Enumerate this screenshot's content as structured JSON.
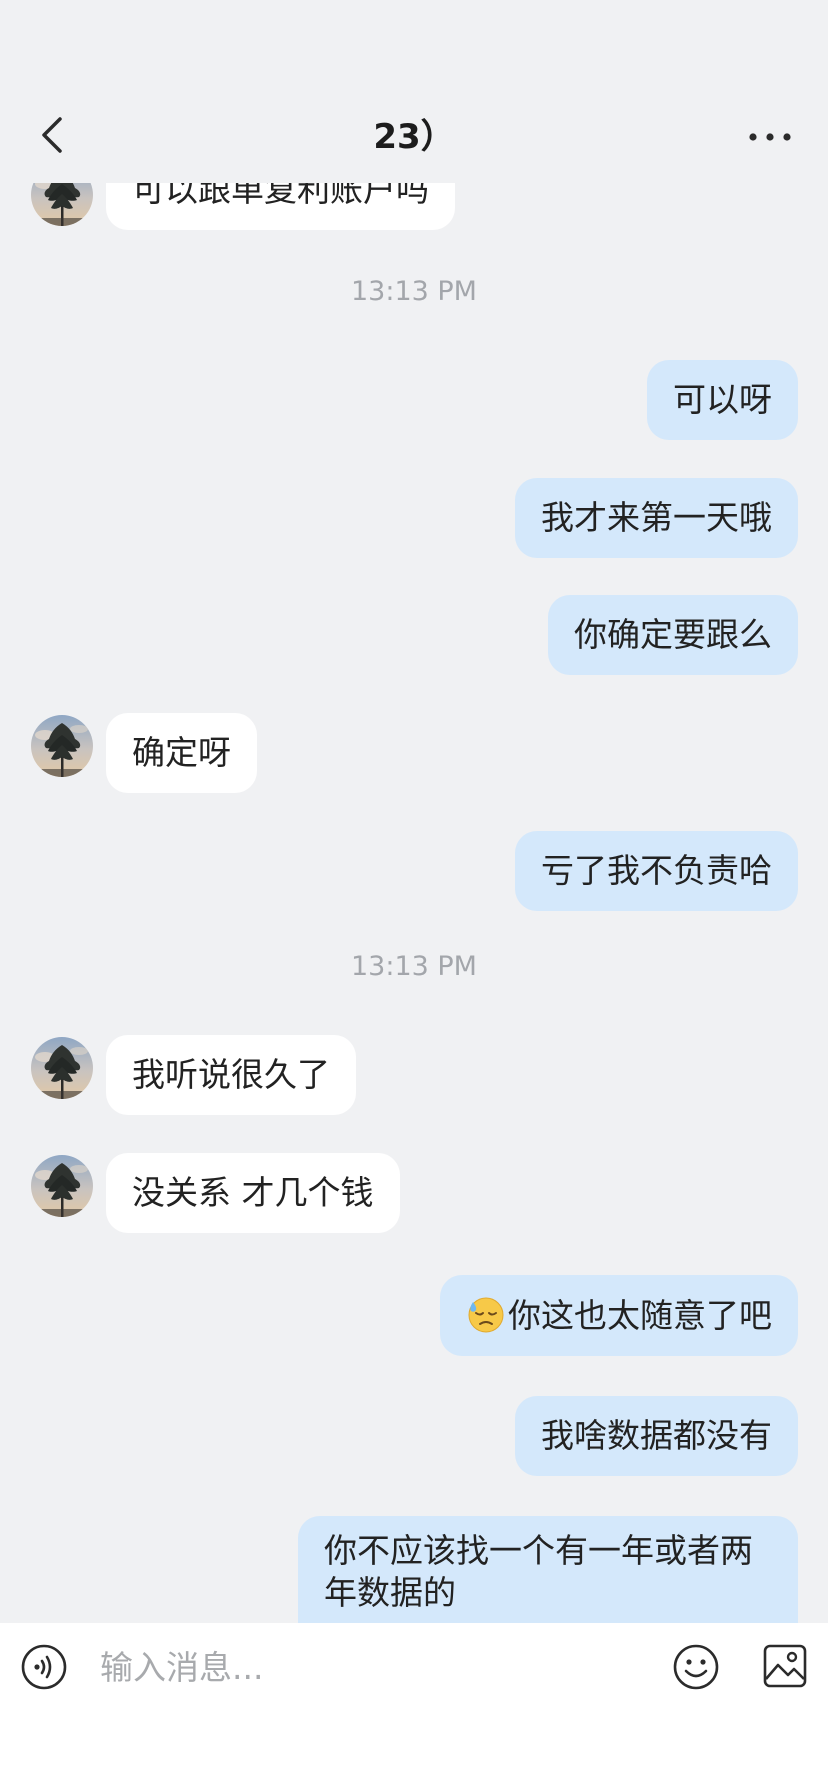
{
  "header": {
    "title": "23）"
  },
  "messages": [
    {
      "id": "m1",
      "side": "in",
      "text": "可以跟单复利账户吗"
    },
    {
      "id": "t1",
      "type": "time",
      "text": "13:13 PM"
    },
    {
      "id": "m2",
      "side": "out",
      "text": "可以呀"
    },
    {
      "id": "m3",
      "side": "out",
      "text": "我才来第一天哦"
    },
    {
      "id": "m4",
      "side": "out",
      "text": "你确定要跟么"
    },
    {
      "id": "m5",
      "side": "in",
      "text": "确定呀"
    },
    {
      "id": "m6",
      "side": "out",
      "text": "亏了我不负责哈"
    },
    {
      "id": "t2",
      "type": "time",
      "text": "13:13 PM"
    },
    {
      "id": "m7",
      "side": "in",
      "text": "我听说很久了"
    },
    {
      "id": "m8",
      "side": "in",
      "text": "没关系 才几个钱"
    },
    {
      "id": "m9",
      "side": "out",
      "emoji": "downcast-sweat-emoji",
      "text": "你这也太随意了吧"
    },
    {
      "id": "m10",
      "side": "out",
      "text": "我啥数据都没有"
    },
    {
      "id": "m11",
      "side": "out",
      "lines": [
        "你不应该找一个有一年或者两",
        "年数据的"
      ]
    }
  ],
  "input_bar": {
    "placeholder": "输入消息..."
  },
  "icons": {
    "back": "chevron-left-icon",
    "more": "more-dots-icon",
    "voice": "voice-icon",
    "emoji": "smiley-icon",
    "image": "image-icon"
  },
  "colors": {
    "background": "#f0f1f3",
    "incoming_bubble": "#ffffff",
    "outgoing_bubble": "#d4e8fb",
    "timestamp": "#a3a6ab"
  }
}
